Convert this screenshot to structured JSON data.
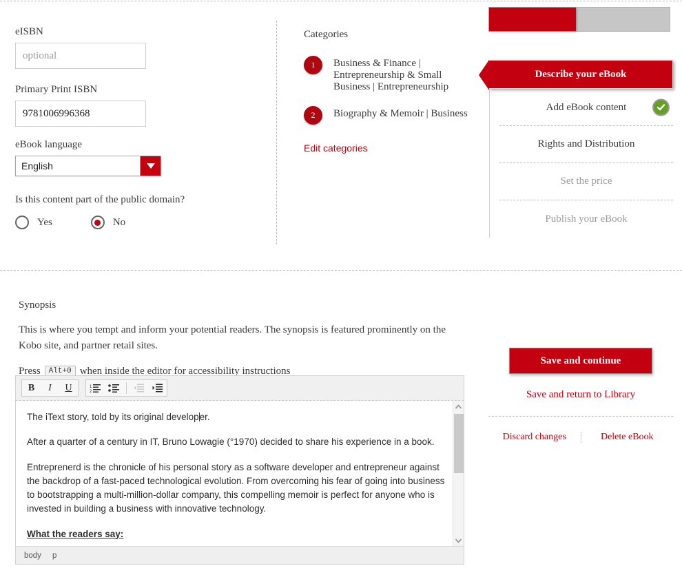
{
  "form": {
    "eisbn": {
      "label": "eISBN",
      "value": "",
      "placeholder": "optional"
    },
    "print_isbn": {
      "label": "Primary Print ISBN",
      "value": "9781006996368",
      "placeholder": ""
    },
    "language": {
      "label": "eBook language",
      "value": "English"
    },
    "public_domain": {
      "question": "Is this content part of the public domain?",
      "yes_label": "Yes",
      "no_label": "No",
      "selected": "No"
    }
  },
  "categories": {
    "title": "Categories",
    "items": [
      {
        "number": "1",
        "text": "Business & Finance | Entrepreneurship & Small Business | Entrepreneurship"
      },
      {
        "number": "2",
        "text": "Biography & Memoir | Business"
      }
    ],
    "edit_link": "Edit categories"
  },
  "sidebar": {
    "progress_percent": 48,
    "steps": [
      {
        "label": "Describe your eBook",
        "state": "active",
        "check": false
      },
      {
        "label": "Add eBook content",
        "state": "enabled",
        "check": true
      },
      {
        "label": "Rights and Distribution",
        "state": "enabled",
        "check": false
      },
      {
        "label": "Set the price",
        "state": "disabled",
        "check": false
      },
      {
        "label": "Publish your eBook",
        "state": "disabled",
        "check": false
      }
    ]
  },
  "actions": {
    "save_continue": "Save and continue",
    "save_return": "Save and return to Library",
    "discard": "Discard changes",
    "delete": "Delete eBook"
  },
  "synopsis": {
    "title": "Synopsis",
    "description": "This is where you tempt and inform your potential readers. The synopsis is featured prominently on the Kobo site, and partner retail sites.",
    "press_prefix": "Press",
    "shortcut": "Alt+0",
    "press_suffix": "when inside the editor for accessibility instructions",
    "toolbar": {
      "bold": "B",
      "italic": "I",
      "underline": "U",
      "ordered_list": "ordered-list-icon",
      "unordered_list": "unordered-list-icon",
      "outdent": "outdent-icon",
      "indent": "indent-icon"
    },
    "content": {
      "p1": "The iText story, told by its original developer.",
      "p2": "After a quarter of a century in IT, Bruno Lowagie (°1970) decided to share his experience in a book.",
      "p3": "Entreprenerd is the chronicle of his personal story as a software developer and entrepreneur against the backdrop of a fast-paced technological evolution. From overcoming his fear of going into business to bootstrapping a multi-million-dollar company, this compelling memoir is perfect for anyone who is invested in building a business with innovative technology.",
      "p4": "What the readers say:"
    },
    "status_path": [
      "body",
      "p"
    ]
  },
  "colors": {
    "brand_red": "#c2000f",
    "badge_red": "#b00610",
    "check_green": "#64a022",
    "progress_track": "#c6c6c6"
  }
}
